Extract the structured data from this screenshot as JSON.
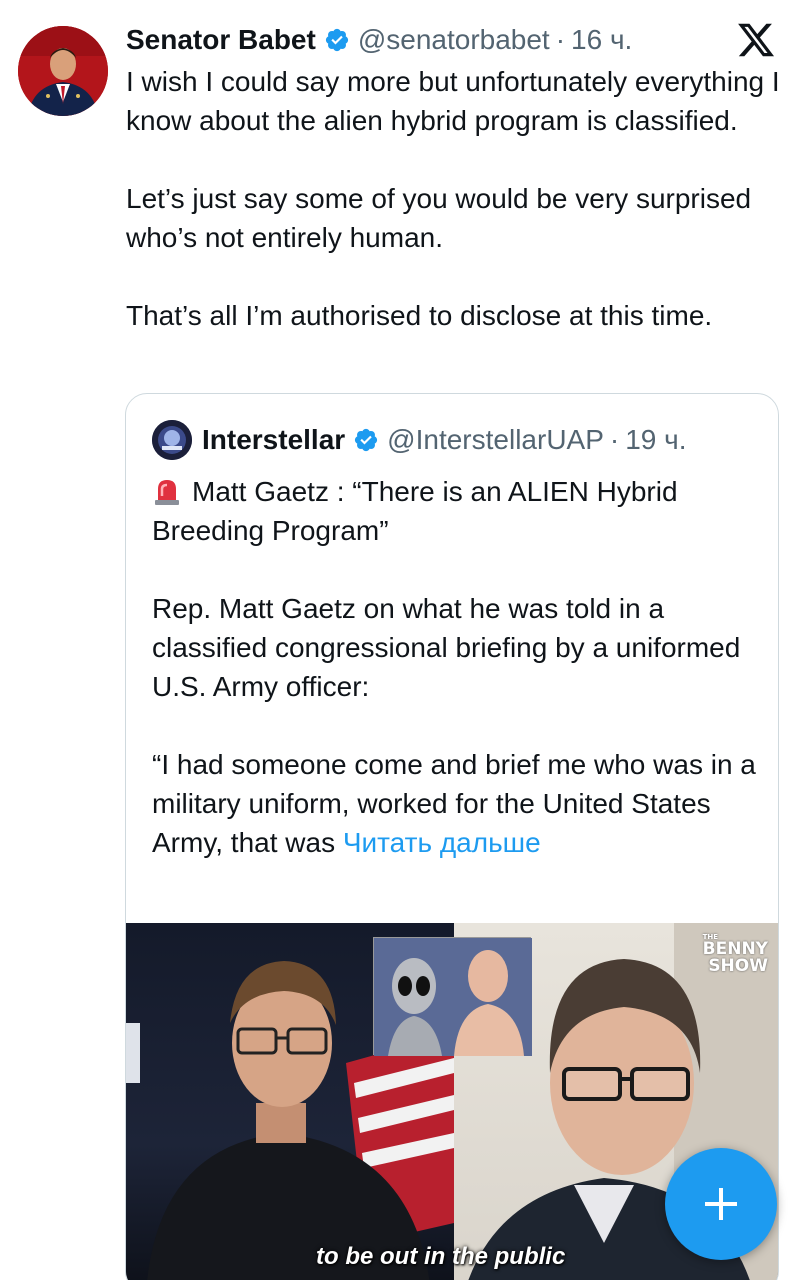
{
  "tweet": {
    "author_name": "Senator Babet",
    "handle": "@senatorbabet",
    "separator": "·",
    "time": "16 ч.",
    "paragraphs": [
      "I wish I could say more but unfortunately everything I know about the alien hybrid program is classified.",
      "Let’s just say some of you would be very surprised who’s not entirely human.",
      "That’s all I’m authorised to disclose at this time."
    ]
  },
  "quote": {
    "author_name": "Interstellar",
    "handle": "@InterstellarUAP",
    "separator": "·",
    "time": "19 ч.",
    "headline": "Matt Gaetz : “There is an ALIEN Hybrid Breeding Program”",
    "paragraph2": "Rep. Matt Gaetz on what he was told in a classified congressional briefing by a uniformed U.S. Army officer:",
    "paragraph3_prefix": "“I had someone come and brief me who was in a military uniform, worked for the United States Army, that was ",
    "read_more": "Читать дальше",
    "video": {
      "logo_small": "THE",
      "logo_line1": "BENNY",
      "logo_line2": "SHOW",
      "caption": "to be out in the public"
    }
  },
  "colors": {
    "link": "#1d9bf0",
    "secondary_text": "#536471",
    "border": "#cfd9de",
    "fab": "#1d9bf0"
  },
  "icons": [
    "x-logo-icon",
    "verified-badge-icon",
    "siren-icon",
    "compose-plus-icon"
  ]
}
